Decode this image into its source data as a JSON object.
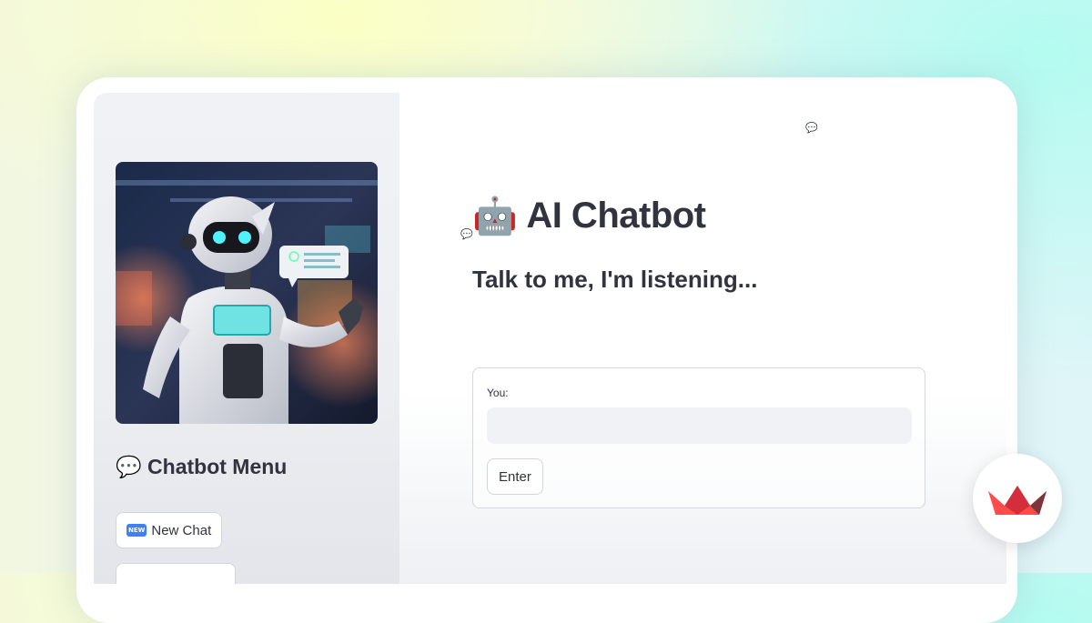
{
  "sidebar": {
    "menu_title": "Chatbot Menu",
    "menu_icon": "speech-balloon-icon",
    "buttons": [
      {
        "label": "New Chat",
        "badge": "NEW"
      }
    ]
  },
  "main": {
    "title": "AI Chatbot",
    "title_icon": "robot-face-icon",
    "subtitle": "Talk to me, I'm listening...",
    "form": {
      "input_label": "You:",
      "input_value": "",
      "submit_label": "Enter"
    }
  },
  "colors": {
    "text": "#31333f",
    "sidebar_bg": "#f0f2f6",
    "input_bg": "#f0f2f6",
    "accent": "#ff4b4b"
  }
}
